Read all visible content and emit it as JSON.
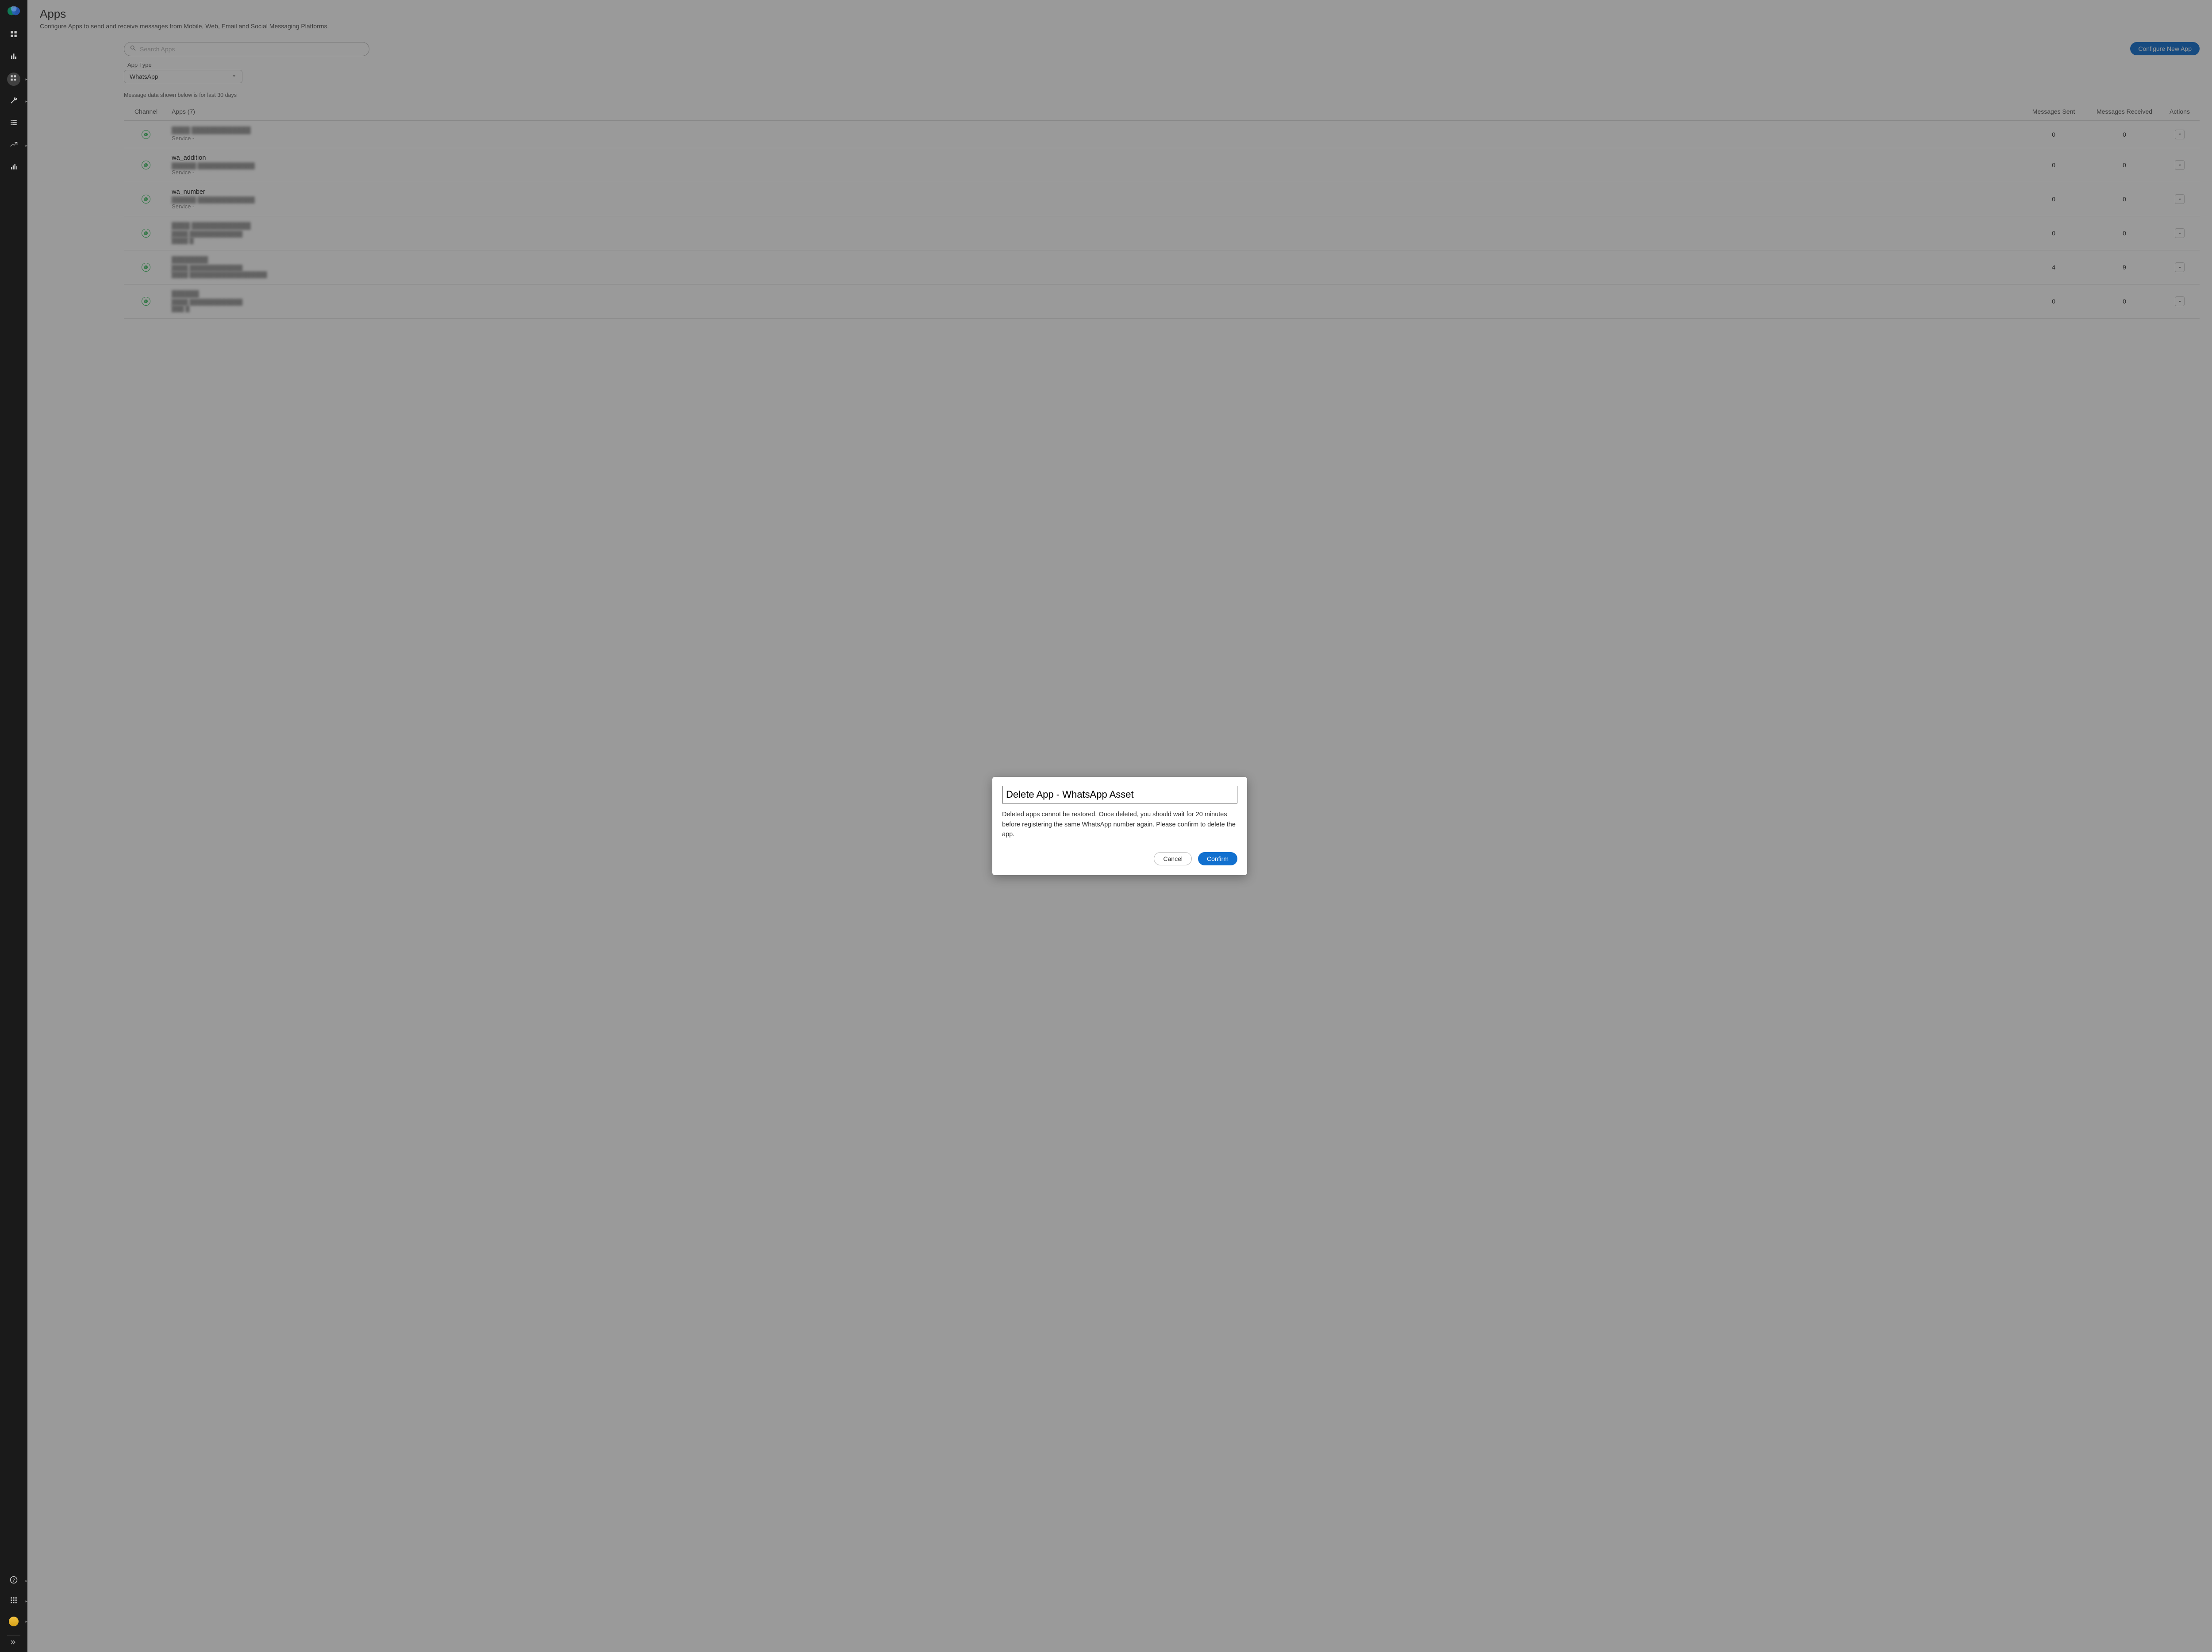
{
  "header": {
    "title": "Apps",
    "subtitle": "Configure Apps to send and receive messages from Mobile, Web, Email and Social Messaging Platforms."
  },
  "controls": {
    "search_placeholder": "Search Apps",
    "app_type_label": "App Type",
    "app_type_value": "WhatsApp",
    "note": "Message data shown below is for last 30 days",
    "configure_button": "Configure New App"
  },
  "table": {
    "cols": {
      "channel": "Channel",
      "apps": "Apps (7)",
      "sent": "Messages Sent",
      "received": "Messages Received",
      "actions": "Actions"
    },
    "rows": [
      {
        "name": "████ █████████████",
        "line2": "",
        "line3": "Service -",
        "sent": "0",
        "received": "0"
      },
      {
        "name": "wa_addition",
        "line2": "██████ ██████████████",
        "line3": "Service -",
        "sent": "0",
        "received": "0"
      },
      {
        "name": "wa_number",
        "line2": "██████ ██████████████",
        "line3": "Service -",
        "sent": "0",
        "received": "0"
      },
      {
        "name": "████ █████████████",
        "line2": "████ █████████████",
        "line3": "████ █",
        "sent": "0",
        "received": "0"
      },
      {
        "name": "████████",
        "line2": "████ █████████████",
        "line3": "████ ███████████████████",
        "sent": "4",
        "received": "9"
      },
      {
        "name": "██████",
        "line2": "████ █████████████",
        "line3": "███ █",
        "sent": "0",
        "received": "0"
      }
    ]
  },
  "modal": {
    "title": "Delete App - WhatsApp Asset",
    "body": "Deleted apps cannot be restored. Once deleted, you should wait for 20 minutes before registering the same WhatsApp number again. Please confirm to delete the app.",
    "cancel": "Cancel",
    "confirm": "Confirm"
  }
}
